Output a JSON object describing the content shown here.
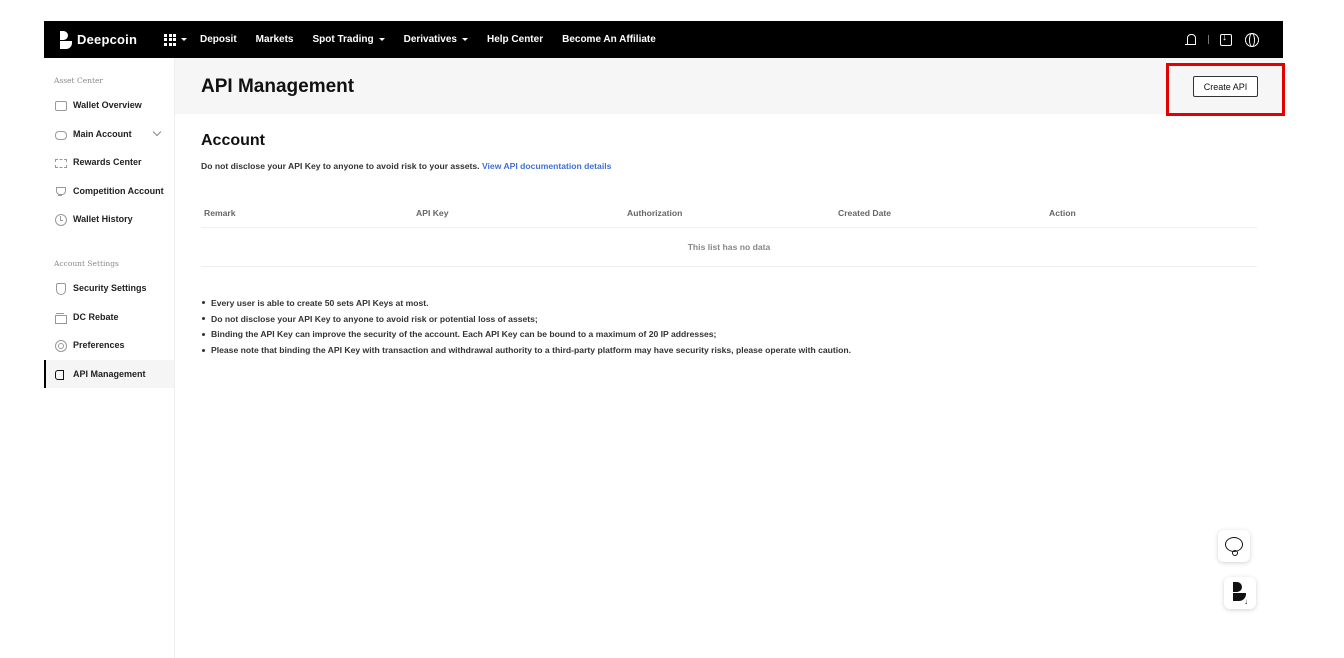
{
  "topbar": {
    "brand": "Deepcoin",
    "nav": [
      {
        "label": "Deposit",
        "dropdown": false
      },
      {
        "label": "Markets",
        "dropdown": false
      },
      {
        "label": "Spot Trading",
        "dropdown": true
      },
      {
        "label": "Derivatives",
        "dropdown": true
      },
      {
        "label": "Help Center",
        "dropdown": false
      },
      {
        "label": "Become An Affiliate",
        "dropdown": false
      }
    ],
    "icons": [
      "user-icon",
      "download-icon",
      "globe-icon"
    ]
  },
  "sidebar": {
    "asset_title": "Asset Center",
    "asset_items": [
      {
        "label": "Wallet Overview",
        "icon": "wallet-icon"
      },
      {
        "label": "Main Account",
        "icon": "account-icon"
      },
      {
        "label": "Rewards Center",
        "icon": "ticket-icon"
      },
      {
        "label": "Competition Account",
        "icon": "trophy-icon"
      },
      {
        "label": "Wallet History",
        "icon": "clock-icon"
      }
    ],
    "settings_title": "Account Settings",
    "settings_items": [
      {
        "label": "Security Settings",
        "icon": "shield-icon"
      },
      {
        "label": "DC Rebate",
        "icon": "gift-icon"
      },
      {
        "label": "Preferences",
        "icon": "gear-icon"
      },
      {
        "label": "API Management",
        "icon": "api-icon",
        "active": true
      }
    ]
  },
  "main": {
    "title": "API Management",
    "create_button": "Create API",
    "section_title": "Account",
    "warning": "Do not disclose your API Key to anyone to avoid risk to your assets.",
    "doc_link": "View API documentation details",
    "table": {
      "columns": [
        "Remark",
        "API Key",
        "Authorization",
        "Created Date",
        "Action"
      ],
      "empty_text": "This list has no data"
    },
    "notes": [
      "Every user is able to create 50 sets API Keys at most.",
      "Do not disclose your API Key to anyone to avoid risk or potential loss of assets;",
      "Binding the API Key can improve the security of the account. Each API Key can be bound to a maximum of 20 IP addresses;",
      "Please note that binding the API Key with transaction and withdrawal authority to a third-party platform may have security risks, please operate with caution."
    ]
  },
  "colors": {
    "topbar": "#000000",
    "link": "#3f6fd8",
    "highlight": "#e30000"
  }
}
